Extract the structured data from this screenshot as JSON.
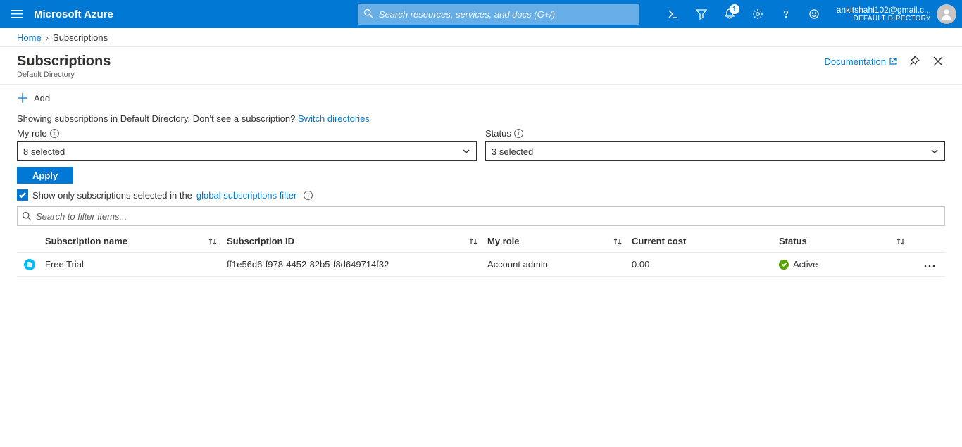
{
  "header": {
    "brand": "Microsoft Azure",
    "search_placeholder": "Search resources, services, and docs (G+/)",
    "notification_count": "1",
    "account_email": "ankitshahi102@gmail.c...",
    "account_directory": "DEFAULT DIRECTORY"
  },
  "breadcrumb": {
    "home": "Home",
    "current": "Subscriptions"
  },
  "blade": {
    "title": "Subscriptions",
    "subtitle": "Default Directory",
    "documentation": "Documentation"
  },
  "toolbar": {
    "add": "Add"
  },
  "message": {
    "pre": "Showing subscriptions in Default Directory. Don't see a subscription? ",
    "link": "Switch directories"
  },
  "filters": {
    "role_label": "My role",
    "role_value": "8 selected",
    "status_label": "Status",
    "status_value": "3 selected"
  },
  "apply": "Apply",
  "checkbox_row": {
    "pre": "Show only subscriptions selected in the ",
    "link": "global subscriptions filter"
  },
  "filter_search_placeholder": "Search to filter items...",
  "table": {
    "headers": {
      "name": "Subscription name",
      "id": "Subscription ID",
      "role": "My role",
      "cost": "Current cost",
      "status": "Status"
    },
    "rows": [
      {
        "name": "Free Trial",
        "id": "ff1e56d6-f978-4452-82b5-f8d649714f32",
        "role": "Account admin",
        "cost": "0.00",
        "status": "Active"
      }
    ]
  }
}
